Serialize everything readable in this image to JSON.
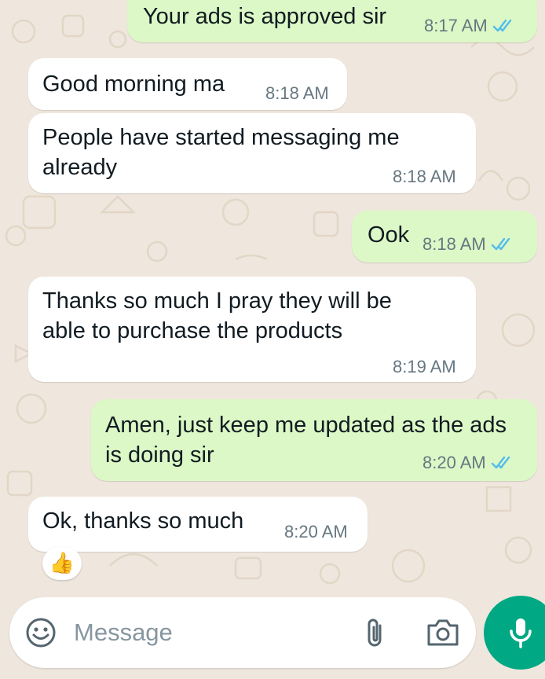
{
  "messages": [
    {
      "text": "Your ads is approved sir",
      "time": "8:17 AM",
      "direction": "outgoing",
      "status": "read"
    },
    {
      "text": "Good morning ma",
      "time": "8:18 AM",
      "direction": "incoming"
    },
    {
      "text": "People have started messaging me already",
      "time": "8:18 AM",
      "direction": "incoming"
    },
    {
      "text": "Ook",
      "time": "8:18 AM",
      "direction": "outgoing",
      "status": "read"
    },
    {
      "text": "Thanks so much I pray they will be able to purchase the products",
      "time": "8:19 AM",
      "direction": "incoming"
    },
    {
      "text": "Amen, just keep me updated as the ads is doing sir",
      "time": "8:20 AM",
      "direction": "outgoing",
      "status": "read"
    },
    {
      "text": "Ok, thanks so much",
      "time": "8:20 AM",
      "direction": "incoming",
      "reaction": "👍"
    }
  ],
  "composer": {
    "placeholder": "Message",
    "icons": [
      "emoji-icon",
      "attach-icon",
      "camera-icon"
    ]
  },
  "mic_button": {
    "icon": "microphone-icon"
  },
  "colors": {
    "outgoing_bubble": "#dcf8c6",
    "incoming_bubble": "#ffffff",
    "read_ticks": "#53bdeb",
    "accent": "#00a884",
    "wallpaper": "#efe7dd"
  }
}
